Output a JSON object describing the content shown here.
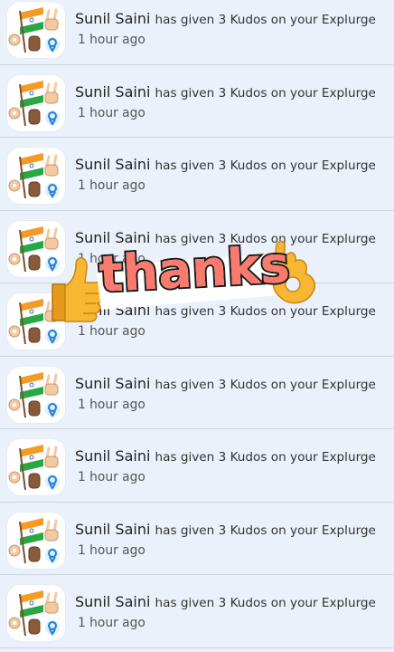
{
  "notifications": [
    {
      "name": "Sunil Saini",
      "message": "has given 3 Kudos on your Explurge",
      "time": "1 hour ago"
    },
    {
      "name": "Sunil Saini",
      "message": "has given 3 Kudos on your Explurge",
      "time": "1 hour ago"
    },
    {
      "name": "Sunil Saini",
      "message": "has given 3 Kudos on your Explurge",
      "time": "1 hour ago"
    },
    {
      "name": "Sunil Saini",
      "message": "has given 3 Kudos on your Explurge",
      "time": "1 hour ago"
    },
    {
      "name": "Sunil Saini",
      "message": "has given 3 Kudos on your Explurge",
      "time": "1 hour ago"
    },
    {
      "name": "Sunil Saini",
      "message": "has given 3 Kudos on your Explurge",
      "time": "1 hour ago"
    },
    {
      "name": "Sunil Saini",
      "message": "has given 3 Kudos on your Explurge",
      "time": "1 hour ago"
    },
    {
      "name": "Sunil Saini",
      "message": "has given 3 Kudos on your Explurge",
      "time": "1 hour ago"
    },
    {
      "name": "Sunil Saini",
      "message": "has given 3 Kudos on your Explurge",
      "time": "1 hour ago"
    }
  ],
  "sticker": {
    "text": "thanks",
    "icons": [
      "thumbs-up-icon",
      "ok-hand-icon"
    ]
  },
  "avatar_icons": [
    "india-flag-icon",
    "ok-hand-icon",
    "victory-hand-icon",
    "raised-fist-icon",
    "blue-ok-hand-icon"
  ],
  "colors": {
    "background": "#eaf1fb",
    "divider": "#cdd5e0",
    "saffron": "#f59a23",
    "green": "#27a844",
    "sticker_text": "#fa7a6e",
    "emoji_yellow": "#f7b733",
    "blue_emoji": "#1f7fd6"
  }
}
